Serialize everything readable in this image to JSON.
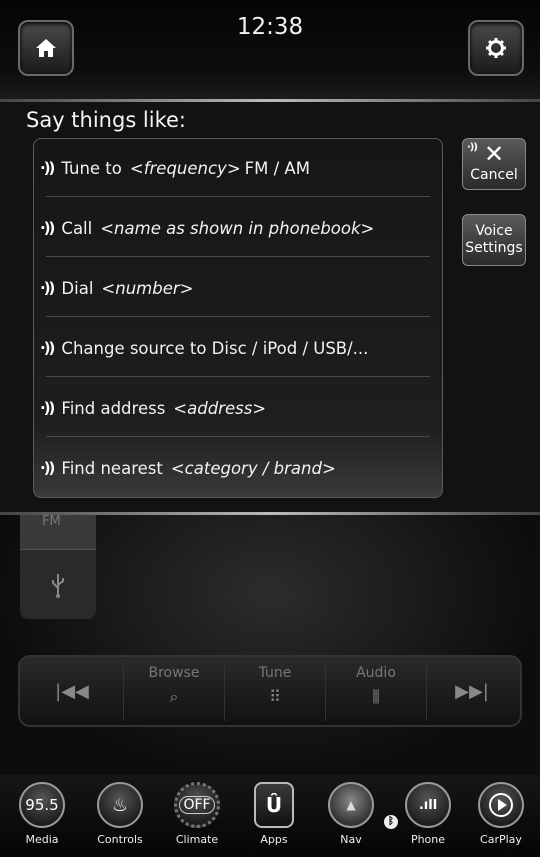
{
  "status": {
    "time": "12:38"
  },
  "header": {
    "home_icon": "home-icon",
    "settings_icon": "gear-icon"
  },
  "voice": {
    "title": "Say things like:",
    "phrases": [
      {
        "text": "Tune to",
        "hint": "<frequency>",
        "suffix": "FM / AM"
      },
      {
        "text": "Call",
        "hint": "<name as shown in phonebook>",
        "suffix": ""
      },
      {
        "text": "Dial",
        "hint": "<number>",
        "suffix": ""
      },
      {
        "text": "Change source to Disc / iPod / USB/...",
        "hint": "",
        "suffix": ""
      },
      {
        "text": "Find address",
        "hint": "<address>",
        "suffix": ""
      },
      {
        "text": "Find nearest",
        "hint": "<category / brand>",
        "suffix": ""
      }
    ],
    "cancel_label": "Cancel",
    "voice_settings_line1": "Voice",
    "voice_settings_line2": "Settings"
  },
  "radio": {
    "source_fm": "FM",
    "controls": {
      "browse": "Browse",
      "tune": "Tune",
      "audio": "Audio"
    }
  },
  "dock": {
    "media_value": "95.5",
    "media": "Media",
    "controls": "Controls",
    "climate_value": "OFF",
    "climate": "Climate",
    "apps": "Apps",
    "nav": "Nav",
    "phone": "Phone",
    "carplay": "CarPlay"
  }
}
